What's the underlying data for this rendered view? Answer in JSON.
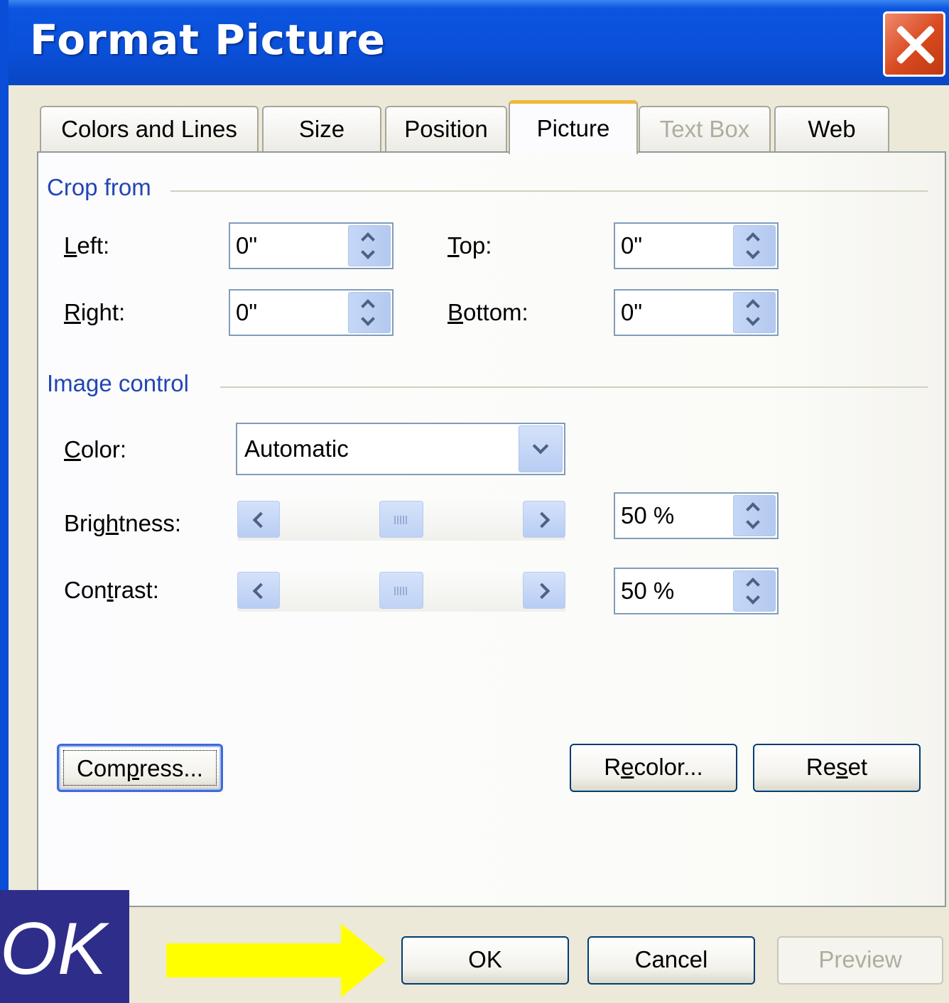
{
  "window": {
    "title": "Format Picture"
  },
  "tabs": [
    {
      "label": "Colors and Lines"
    },
    {
      "label": "Size"
    },
    {
      "label": "Position"
    },
    {
      "label": "Picture",
      "active": true
    },
    {
      "label": "Text Box",
      "disabled": true
    },
    {
      "label": "Web"
    }
  ],
  "crop": {
    "group_label": "Crop from",
    "left": {
      "pre": "",
      "key": "L",
      "post": "eft:",
      "value": "0\""
    },
    "top": {
      "pre": "",
      "key": "T",
      "post": "op:",
      "value": "0\""
    },
    "right": {
      "pre": "",
      "key": "R",
      "post": "ight:",
      "value": "0\""
    },
    "bottom": {
      "pre": "",
      "key": "B",
      "post": "ottom:",
      "value": "0\""
    }
  },
  "image_control": {
    "group_label": "Image control",
    "color": {
      "pre": "",
      "key": "C",
      "post": "olor:",
      "value": "Automatic"
    },
    "brightness": {
      "pre": "Brig",
      "key": "h",
      "post": "tness:",
      "value": "50 %",
      "level": 0.5
    },
    "contrast": {
      "pre": "Con",
      "key": "t",
      "post": "rast:",
      "value": "50 %",
      "level": 0.5
    }
  },
  "buttons": {
    "compress": {
      "pre": "Com",
      "key": "p",
      "post": "ress..."
    },
    "recolor": {
      "pre": "R",
      "key": "e",
      "post": "color..."
    },
    "reset": {
      "pre": "Re",
      "key": "s",
      "post": "et"
    },
    "ok": "OK",
    "cancel": "Cancel",
    "preview": "Preview"
  },
  "overlay": {
    "label": "OK",
    "arrow_color": "#ffff00",
    "box_color": "#2f2d8a"
  },
  "colors": {
    "accent": "#2146b4",
    "titlebar": "#0a4fd8",
    "close": "#d8491f",
    "active_tab_indicator": "#f2b73a"
  }
}
